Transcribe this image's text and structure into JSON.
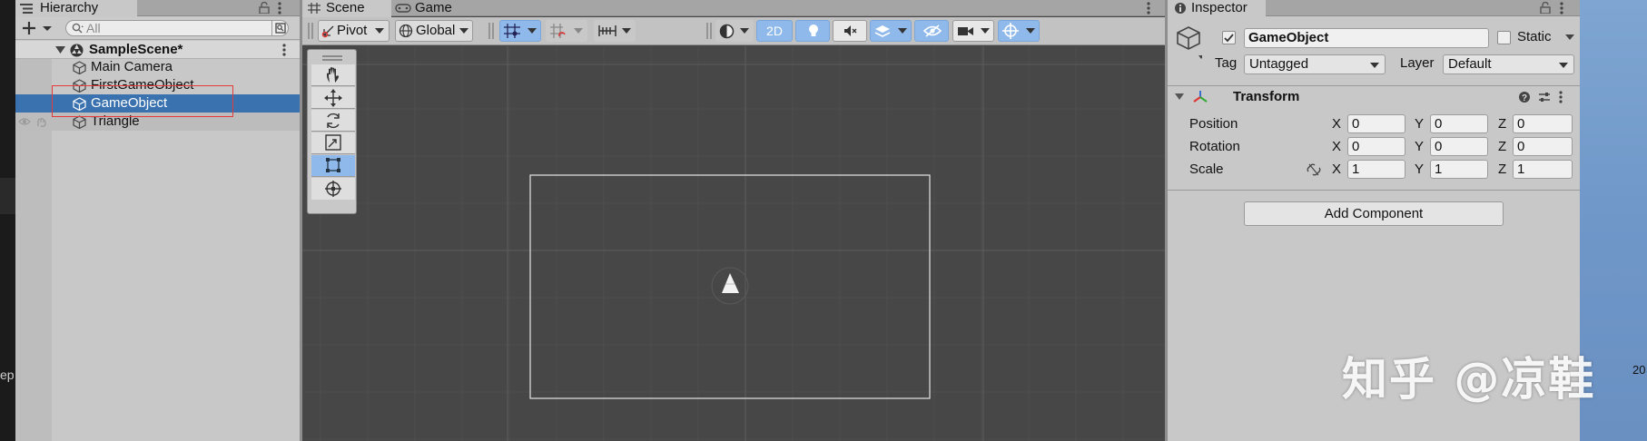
{
  "hierarchy": {
    "tab_label": "Hierarchy",
    "search_placeholder": "All",
    "scene_name": "SampleScene*",
    "items": [
      {
        "label": "Main Camera"
      },
      {
        "label": "FirstGameObject"
      },
      {
        "label": "GameObject"
      },
      {
        "label": "Triangle"
      }
    ]
  },
  "scene_view": {
    "tabs": [
      {
        "label": "Scene"
      },
      {
        "label": "Game"
      }
    ],
    "toolbar": {
      "pivot_label": "Pivot",
      "global_label": "Global",
      "mode_2d_label": "2D"
    }
  },
  "inspector": {
    "tab_label": "Inspector",
    "object_name": "GameObject",
    "static_label": "Static",
    "tag_label": "Tag",
    "tag_value": "Untagged",
    "layer_label": "Layer",
    "layer_value": "Default",
    "transform": {
      "title": "Transform",
      "rows": [
        {
          "label": "Position",
          "x": "0",
          "y": "0",
          "z": "0"
        },
        {
          "label": "Rotation",
          "x": "0",
          "y": "0",
          "z": "0"
        },
        {
          "label": "Scale",
          "x": "1",
          "y": "1",
          "z": "1"
        }
      ],
      "axis_x": "X",
      "axis_y": "Y",
      "axis_z": "Z"
    },
    "add_component_label": "Add Component"
  },
  "watermark": "知乎 @凉鞋",
  "left_strip_text": "ep",
  "right_edge_text": "20"
}
